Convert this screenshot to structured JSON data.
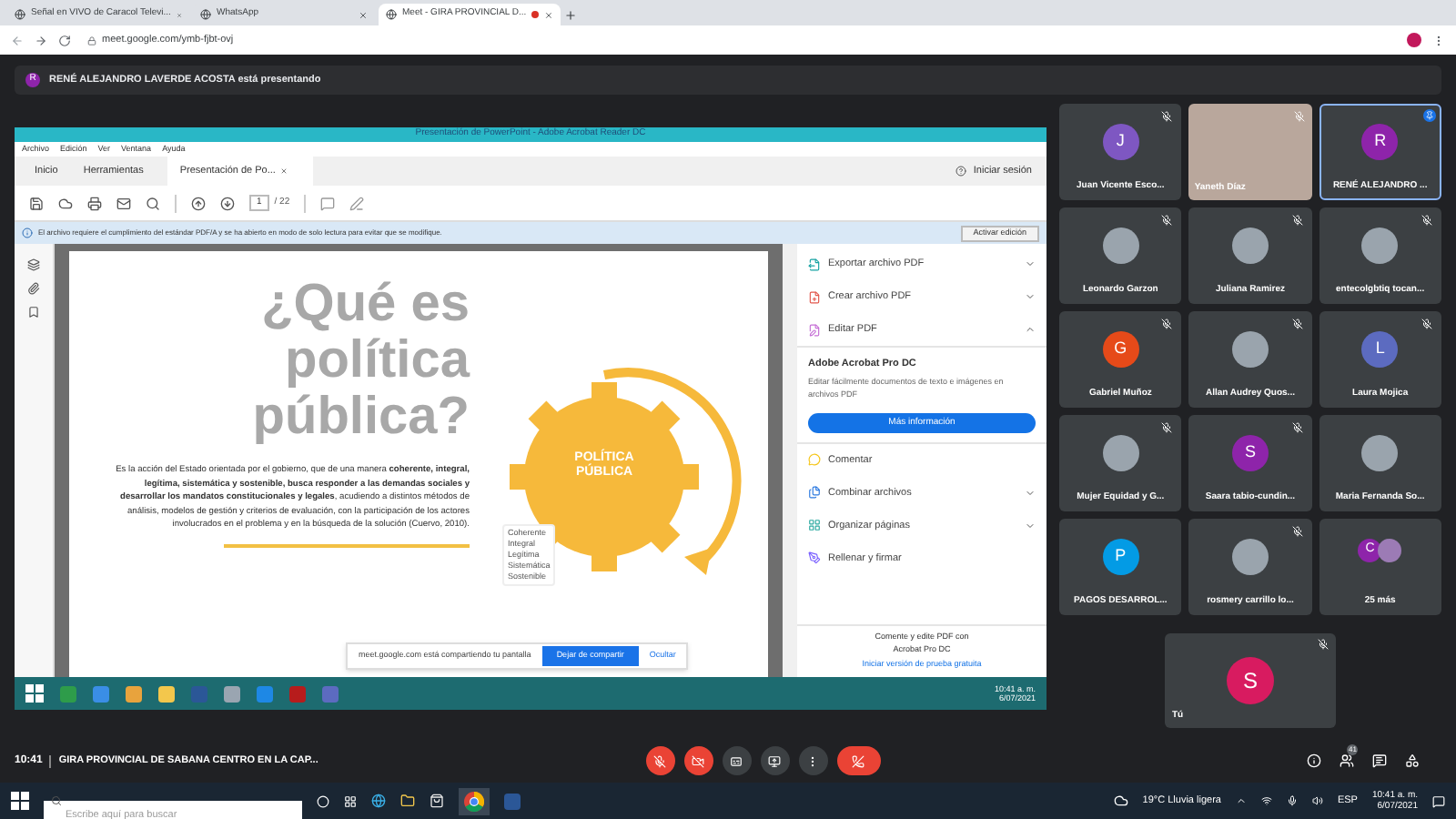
{
  "browser": {
    "tabs": [
      {
        "title": "Señal en VIVO de Caracol Televi...",
        "selected": false,
        "recording": false
      },
      {
        "title": "WhatsApp",
        "selected": false,
        "recording": false
      },
      {
        "title": "Meet - GIRA PROVINCIAL D...",
        "selected": true,
        "recording": true
      }
    ],
    "url": "meet.google.com/ymb-fjbt-ovj"
  },
  "presenter_banner": {
    "initial": "R",
    "text": "RENÉ ALEJANDRO LAVERDE ACOSTA está presentando"
  },
  "shared_screen": {
    "title": "Presentación de PowerPoint - Adobe Acrobat Reader DC",
    "menu": [
      "Archivo",
      "Edición",
      "Ver",
      "Ventana",
      "Ayuda"
    ],
    "tabs": [
      {
        "label": "Inicio",
        "selected": false
      },
      {
        "label": "Herramientas",
        "selected": false
      },
      {
        "label": "Presentación de Po...",
        "selected": true
      }
    ],
    "signin": "Iniciar sesión",
    "page": "1",
    "page_total": "/ 22",
    "info_bar": {
      "text": "El archivo requiere el cumplimiento del estándar PDF/A y se ha abierto en modo de solo lectura para evitar que se modifique.",
      "button": "Activar edición"
    },
    "slide": {
      "title_lines": [
        "¿Qué es",
        "política",
        "pública?"
      ],
      "body": "Es la acción del Estado orientada por el gobierno, que de una manera **coherente, integral, legítima, sistemática y sostenible, busca responder a las demandas sociales y desarrollar los mandatos constitucionales y legales**, acudiendo a distintos métodos de análisis, modelos de gestión y criterios de evaluación, con la participación de los actores involucrados en el problema y en la búsqueda de la solución (Cuervo, 2010).",
      "gear_lines": [
        "POLÍTICA",
        "PÚBLICA"
      ],
      "attributes": [
        "Coherente",
        "Integral",
        "Legítima",
        "Sistemática",
        "Sostenible"
      ]
    },
    "tools": [
      {
        "kind": "menu",
        "label": "Exportar archivo PDF",
        "expanded": false
      },
      {
        "kind": "menu",
        "label": "Crear archivo PDF",
        "expanded": false
      },
      {
        "kind": "menu",
        "label": "Editar PDF",
        "expanded": true
      }
    ],
    "promo": {
      "title": "Adobe Acrobat Pro DC",
      "text": "Editar fácilmente documentos de texto e imágenes en archivos PDF",
      "button": "Más información"
    },
    "tools_more": [
      {
        "kind": "link",
        "label": "Comentar"
      },
      {
        "kind": "menu",
        "label": "Combinar archivos",
        "expanded": false
      },
      {
        "kind": "menu",
        "label": "Organizar páginas",
        "expanded": false
      },
      {
        "kind": "link",
        "label": "Rellenar y firmar"
      }
    ],
    "pane_footer": {
      "text": "Comente y edite PDF con Acrobat Pro DC",
      "link": "Iniciar versión de prueba gratuita"
    },
    "taskbar": {
      "time": "10:41 a. m.",
      "date": "6/07/2021"
    },
    "share_bar": {
      "text": "meet.google.com está compartiendo tu pantalla",
      "stop": "Dejar de compartir",
      "hide": "Ocultar"
    }
  },
  "participants": [
    {
      "kind": "letter",
      "name": "Juan Vicente Esco...",
      "initial": "J",
      "color": "#7e57c2",
      "muted": true,
      "selected": false
    },
    {
      "kind": "video",
      "name": "Yaneth Díaz",
      "muted": true,
      "selected": false
    },
    {
      "kind": "letter",
      "name": "RENÉ ALEJANDRO ...",
      "initial": "R",
      "color": "#8e24aa",
      "muted": false,
      "selected": true
    },
    {
      "kind": "photo",
      "name": "Leonardo Garzon",
      "muted": true,
      "selected": false
    },
    {
      "kind": "photo",
      "name": "Juliana Ramirez",
      "muted": true,
      "selected": false
    },
    {
      "kind": "photo",
      "name": "entecolgbtiq tocan...",
      "muted": true,
      "selected": false
    },
    {
      "kind": "letter",
      "name": "Gabriel Muñoz",
      "initial": "G",
      "color": "#e64a19",
      "muted": true,
      "selected": false
    },
    {
      "kind": "photo",
      "name": "Allan Audrey Quos...",
      "muted": true,
      "selected": false
    },
    {
      "kind": "letter",
      "name": "Laura Mojica",
      "initial": "L",
      "color": "#5c6bc0",
      "muted": true,
      "selected": false
    },
    {
      "kind": "photo",
      "name": "Mujer Equidad y G...",
      "muted": true,
      "selected": false
    },
    {
      "kind": "letter",
      "name": "Saara tabio-cundin...",
      "initial": "S",
      "color": "#8e24aa",
      "muted": true,
      "selected": false
    },
    {
      "kind": "photo",
      "name": "Maria Fernanda So...",
      "muted": false,
      "selected": false
    },
    {
      "kind": "letter",
      "name": "PAGOS DESARROL...",
      "initial": "P",
      "color": "#039be5",
      "muted": false,
      "selected": false
    },
    {
      "kind": "photo",
      "name": "rosmery carrillo lo...",
      "muted": true,
      "selected": false
    },
    {
      "kind": "more",
      "name": "25 más",
      "initial": "C",
      "color": "#8e24aa",
      "muted": false,
      "selected": false
    }
  ],
  "self": {
    "name": "Tú",
    "initial": "S",
    "color": "#d81b60",
    "muted": true
  },
  "bottom_bar": {
    "time": "10:41",
    "title": "GIRA PROVINCIAL DE SABANA CENTRO EN LA CAP...",
    "people_count": "41"
  },
  "taskbar": {
    "search_placeholder": "Escribe aquí para buscar",
    "weather": "19°C Lluvia ligera",
    "language": "ESP",
    "time": "10:41 a. m.",
    "date": "6/07/2021"
  }
}
